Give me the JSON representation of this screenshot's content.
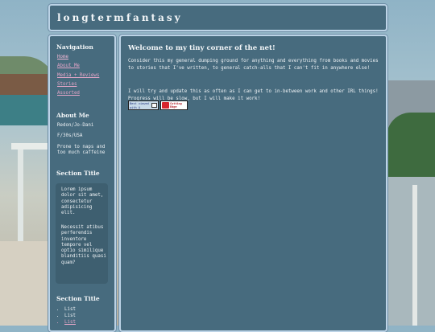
{
  "site": {
    "title": "longtermfantasy"
  },
  "sidebar": {
    "nav_title": "Navigation",
    "nav_items": [
      {
        "label": "Home"
      },
      {
        "label": "About Me"
      },
      {
        "label": "Media + Reviews"
      },
      {
        "label": "Stories"
      },
      {
        "label": "Assorted"
      }
    ],
    "about": {
      "title": "About Me",
      "name": "Redon/Jo-Dani",
      "info": "F/30s/USA",
      "note": "Prone to naps and too much caffeine"
    },
    "section1": {
      "title": "Section Title",
      "paragraphs": [
        "Lorem ipsum dolor sit amet, consectetur adipisicing elit.",
        "Necessit atibus perferendis inventore tempore vel optio similique blanditiis quasi quam?"
      ]
    },
    "section2": {
      "title": "Section Title",
      "items": [
        "List",
        "List",
        "List"
      ]
    }
  },
  "main": {
    "heading": "Welcome to my tiny corner of the net!",
    "paragraphs": [
      "Consider this my general dumping ground for anything and everything from books and movies to stories that I've written, to general catch-alls that I can't fit in anywhere else!",
      "I will try and update this as often as I can get to in-between work and other IRL things! Progress will be slow, but I will make it work!"
    ],
    "badges": [
      {
        "text": "Best viewed with A COMPUTER",
        "icon": "computer-icon"
      },
      {
        "text": "Cutting Edge DESIGN without AI",
        "icon": "no-ai-icon"
      }
    ]
  },
  "colors": {
    "panel": "#476b7e",
    "panel_border": "#bcd3e6",
    "link": "#e4a6c8",
    "text": "#eef2f5"
  }
}
